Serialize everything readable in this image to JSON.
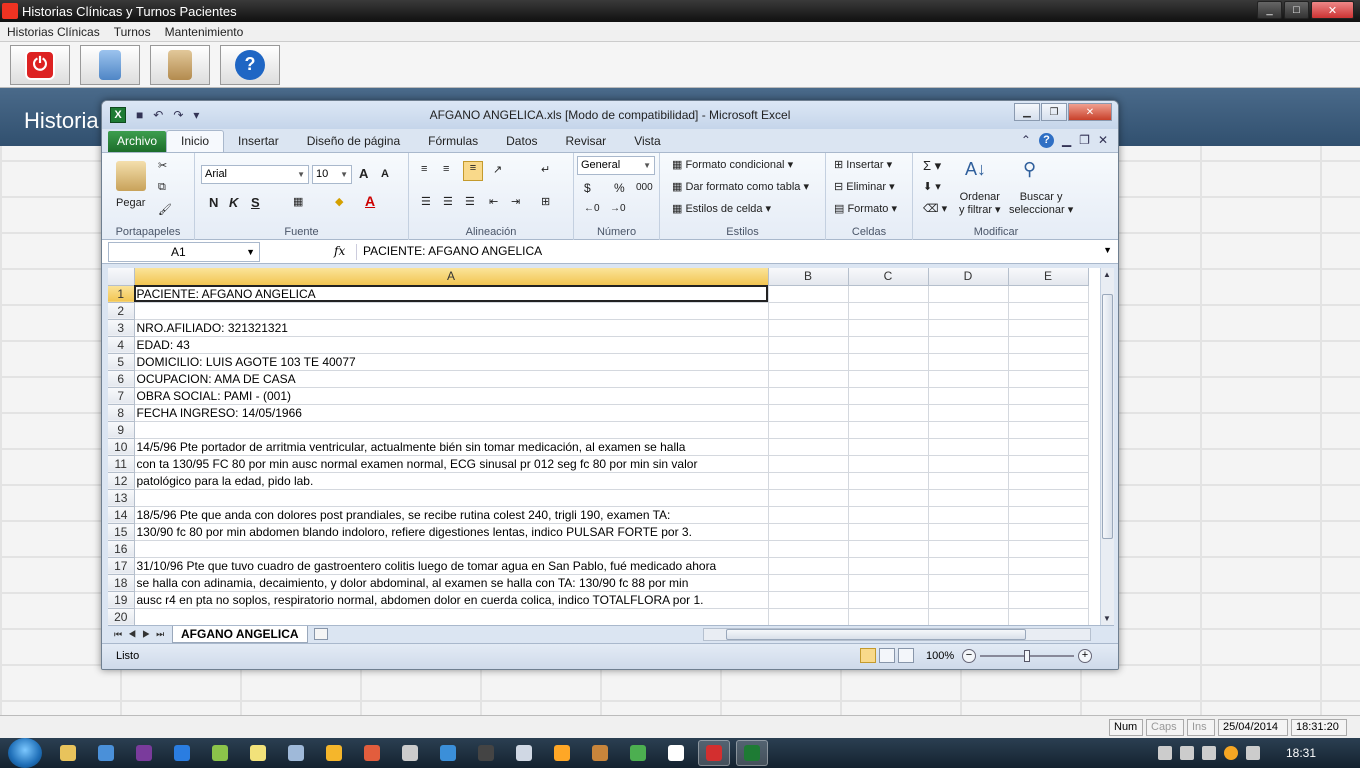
{
  "app": {
    "title": "Historias Clínicas y Turnos Pacientes",
    "menu": [
      "Historias Clínicas",
      "Turnos",
      "Mantenimiento"
    ],
    "toolbar_icons": [
      "power-icon",
      "calculator-icon",
      "clipboard-icon",
      "help-icon"
    ],
    "header_title": "Historia",
    "status": {
      "num": "Num",
      "caps": "Caps",
      "ins": "Ins",
      "date": "25/04/2014",
      "time": "18:31:20"
    }
  },
  "excel": {
    "caption": "AFGANO ANGELICA.xls  [Modo de compatibilidad]  -  Microsoft Excel",
    "tabs": [
      "Archivo",
      "Inicio",
      "Insertar",
      "Diseño de página",
      "Fórmulas",
      "Datos",
      "Revisar",
      "Vista"
    ],
    "active_tab": "Inicio",
    "ribbon": {
      "clipboard": {
        "label": "Portapapeles",
        "paste": "Pegar"
      },
      "font": {
        "label": "Fuente",
        "name": "Arial",
        "size": "10",
        "bold": "N",
        "italic": "K",
        "underline": "S",
        "grow": "A",
        "shrink": "A",
        "color": "A"
      },
      "alignment": {
        "label": "Alineación"
      },
      "number": {
        "label": "Número",
        "format": "General",
        "currency": "$",
        "percent": "%",
        "thousands": "000"
      },
      "styles": {
        "label": "Estilos",
        "conditional": "Formato condicional",
        "table": "Dar formato como tabla",
        "cell_styles": "Estilos de celda"
      },
      "cells": {
        "label": "Celdas",
        "insert": "Insertar",
        "delete": "Eliminar",
        "format": "Formato"
      },
      "editing": {
        "label": "Modificar",
        "sort_1": "Ordenar",
        "sort_2": "y filtrar",
        "find_1": "Buscar y",
        "find_2": "seleccionar"
      }
    },
    "name_box": "A1",
    "fx": "fx",
    "formula": "PACIENTE: AFGANO ANGELICA",
    "columns": [
      "A",
      "B",
      "C",
      "D",
      "E"
    ],
    "rows": [
      "PACIENTE: AFGANO ANGELICA",
      "",
      "NRO.AFILIADO: 321321321",
      "EDAD:  43",
      "DOMICILIO: LUIS AGOTE 103   TE 40077",
      "OCUPACION: AMA DE CASA",
      "OBRA SOCIAL: PAMI - (001)",
      "FECHA INGRESO: 14/05/1966",
      "",
      "14/5/96 Pte portador de arritmia ventricular, actualmente bién sin tomar medicación, al examen se halla",
      "con ta 130/95 FC 80 por min ausc normal examen normal, ECG sinusal pr 012 seg fc 80 por min sin valor",
      "patológico para la  edad, pido lab.",
      "",
      "18/5/96 Pte que anda con dolores post prandiales, se recibe rutina colest 240, trigli 190, examen TA:",
      "130/90 fc 80 por min abdomen blando indoloro, refiere digestiones lentas, indico PULSAR FORTE  por 3.",
      "",
      "31/10/96 Pte que tuvo cuadro de gastroentero colitis luego de tomar agua en San Pablo, fué medicado ahora",
      "se halla con adinamia, decaimiento, y dolor abdominal, al examen se halla con TA: 130/90 fc 88 por min",
      "ausc r4 en pta no soplos, respiratorio normal, abdomen dolor en cuerda colica, indico TOTALFLORA por 1.",
      ""
    ],
    "sheet_tab": "AFGANO ANGELICA",
    "status_ready": "Listo",
    "zoom": "100%"
  },
  "taskbar": {
    "clock": "18:31",
    "apps": [
      "explorer-icon",
      "control-panel-icon",
      "winrar-icon",
      "app-icon",
      "utorrent-icon",
      "notes-icon",
      "calculator-icon",
      "alert-icon",
      "network-icon",
      "media-icon",
      "translate-icon",
      "cmd-icon",
      "window-icon",
      "weather-icon",
      "cat-icon",
      "chrome-icon",
      "document-icon",
      "historias-app-icon",
      "excel-icon"
    ]
  }
}
